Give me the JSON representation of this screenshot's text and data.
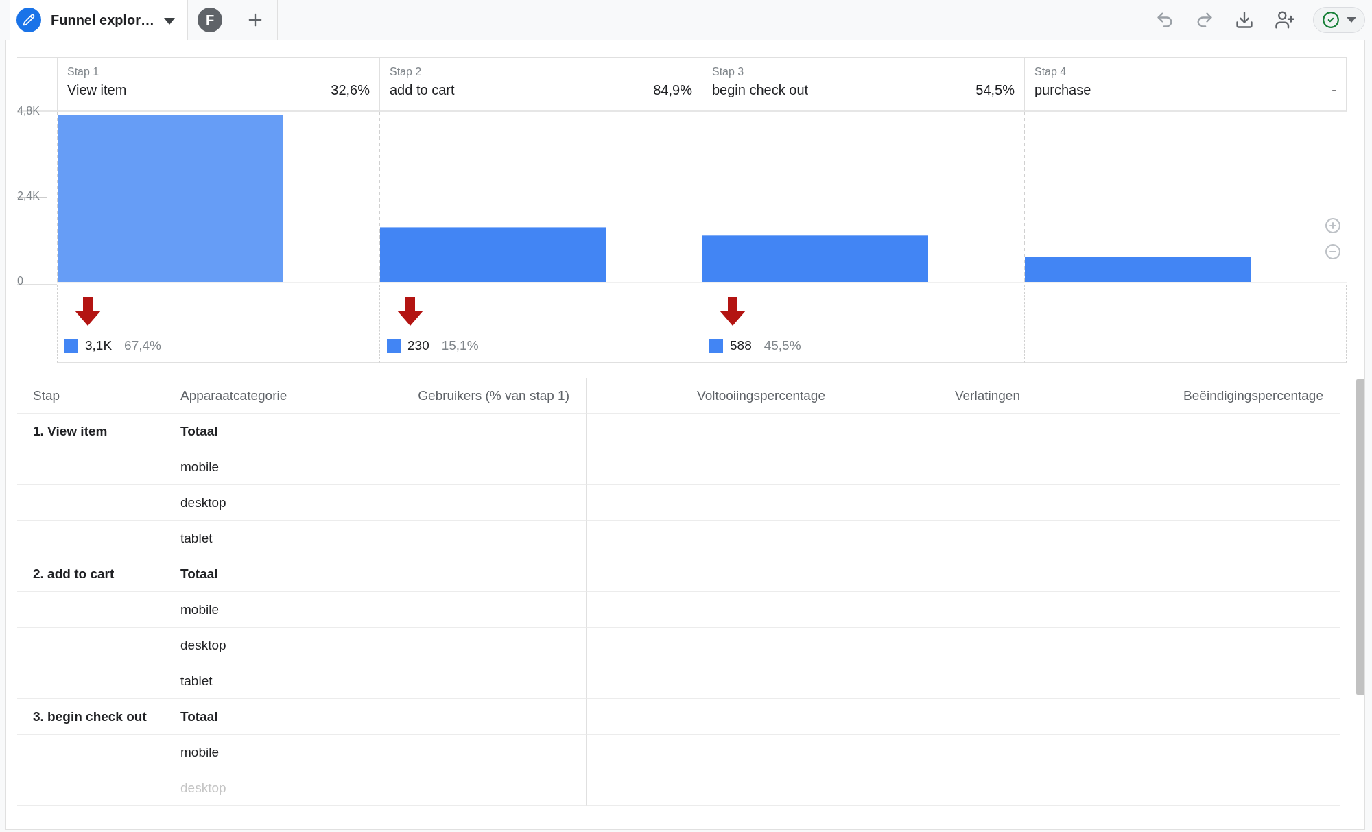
{
  "tabs": [
    {
      "label": "Funnel explor…",
      "selected": true
    },
    {
      "label": "F",
      "selected": false
    }
  ],
  "steps": [
    {
      "label": "Stap 1",
      "name": "View item",
      "rate": "32,6%",
      "highlighted": true,
      "drop": {
        "count": "3,1K",
        "percent": "67,4%"
      }
    },
    {
      "label": "Stap 2",
      "name": "add to cart",
      "rate": "84,9%",
      "highlighted": false,
      "drop": {
        "count": "230",
        "percent": "15,1%"
      }
    },
    {
      "label": "Stap 3",
      "name": "begin check out",
      "rate": "54,5%",
      "highlighted": false,
      "drop": {
        "count": "588",
        "percent": "45,5%"
      }
    },
    {
      "label": "Stap 4",
      "name": "purchase",
      "rate": "-",
      "highlighted": false
    }
  ],
  "chart_data": {
    "type": "bar",
    "values": [
      4720,
      1540,
      1310,
      710
    ],
    "ylim": [
      0,
      4800
    ],
    "yticks": [
      {
        "value": 0,
        "label": "0"
      },
      {
        "value": 2400,
        "label": "2,4K"
      },
      {
        "value": 4800,
        "label": "4,8K"
      }
    ]
  },
  "table": {
    "columns": [
      "Stap",
      "Apparaatcategorie",
      "Gebruikers (% van stap 1)",
      "Voltooiingspercentage",
      "Verlatingen",
      "Beëindigingspercentage"
    ],
    "groups": [
      {
        "step": "1. View item",
        "rows": [
          "Totaal",
          "mobile",
          "desktop",
          "tablet"
        ]
      },
      {
        "step": "2. add to cart",
        "rows": [
          "Totaal",
          "mobile",
          "desktop",
          "tablet"
        ]
      },
      {
        "step": "3. begin check out",
        "rows": [
          "Totaal",
          "mobile",
          "desktop"
        ]
      }
    ]
  }
}
